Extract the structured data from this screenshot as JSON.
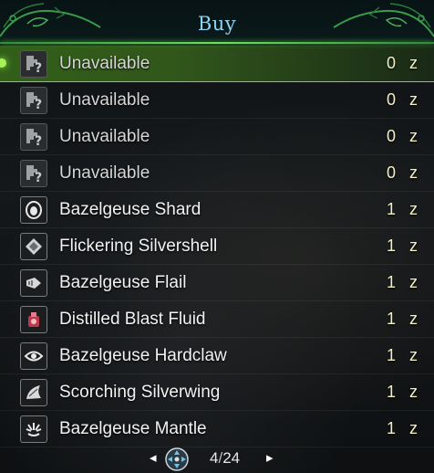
{
  "title": "Buy",
  "currency_symbol": "z",
  "items": [
    {
      "name": "Unavailable",
      "price": "0",
      "icon": "locked-item-icon",
      "selected": true
    },
    {
      "name": "Unavailable",
      "price": "0",
      "icon": "locked-item-icon"
    },
    {
      "name": "Unavailable",
      "price": "0",
      "icon": "locked-item-icon"
    },
    {
      "name": "Unavailable",
      "price": "0",
      "icon": "locked-item-icon"
    },
    {
      "name": "Bazelgeuse Shard",
      "price": "1",
      "icon": "shard-icon"
    },
    {
      "name": "Flickering Silvershell",
      "price": "1",
      "icon": "shell-icon"
    },
    {
      "name": "Bazelgeuse Flail",
      "price": "1",
      "icon": "tail-icon"
    },
    {
      "name": "Distilled Blast Fluid",
      "price": "1",
      "icon": "fluid-icon"
    },
    {
      "name": "Bazelgeuse Hardclaw",
      "price": "1",
      "icon": "claw-icon"
    },
    {
      "name": "Scorching Silverwing",
      "price": "1",
      "icon": "wing-icon"
    },
    {
      "name": "Bazelgeuse Mantle",
      "price": "1",
      "icon": "mantle-icon"
    }
  ],
  "pager": {
    "current": "4",
    "separator": "/",
    "total": "24",
    "icons": [
      "arrow-left-icon",
      "dpad-icon",
      "arrow-right-icon"
    ]
  },
  "colors": {
    "accent_green": "#6ee05a",
    "title_blue": "#8fd4f0",
    "price_cream": "#f4f0c8"
  }
}
